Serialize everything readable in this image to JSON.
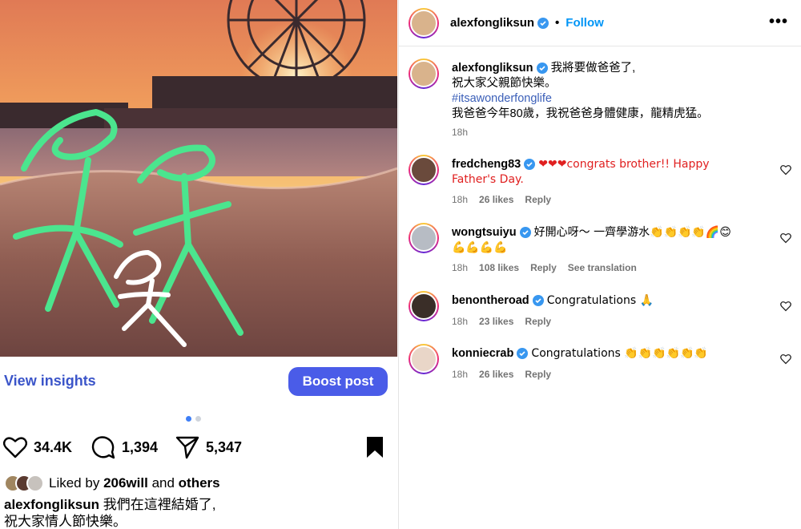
{
  "left_panel": {
    "view_insights_label": "View insights",
    "boost_label": "Boost post",
    "like_count": "34.4K",
    "comment_count": "1,394",
    "share_count": "5,347",
    "liked_by_prefix": "Liked by",
    "liked_by_user": "206will",
    "liked_by_and": "and",
    "liked_by_others": "others",
    "caption_user": "alexfongliksun",
    "caption_line1": "我們在這裡結婚了,",
    "caption_line2": "祝大家情人節快樂。",
    "carousel": {
      "count": 2,
      "active_index": 0
    }
  },
  "header": {
    "username": "alexfongliksun",
    "separator": "•",
    "follow_label": "Follow",
    "more_label": "•••"
  },
  "post_caption": {
    "username": "alexfongliksun",
    "line1": "我將要做爸爸了,",
    "line2": "祝大家父親節快樂。",
    "hashtag": "#itsawonderfonglife",
    "line3": "我爸爸今年80歲，我祝爸爸身體健康，龍精虎猛。",
    "time": "18h"
  },
  "comments": [
    {
      "username": "fredcheng83",
      "text": "❤❤❤congrats brother!! Happy Father's Day.",
      "time": "18h",
      "likes": "26 likes",
      "reply": "Reply",
      "translation": ""
    },
    {
      "username": "wongtsuiyu",
      "text": "好開心呀～ 一齊學游水👏👏👏👏🌈😊💪💪💪💪",
      "time": "18h",
      "likes": "108 likes",
      "reply": "Reply",
      "translation": "See translation"
    },
    {
      "username": "benontheroad",
      "text": "Congratulations 🙏",
      "time": "18h",
      "likes": "23 likes",
      "reply": "Reply",
      "translation": ""
    },
    {
      "username": "konniecrab",
      "text": "Congratulations 👏👏👏👏👏👏",
      "time": "18h",
      "likes": "26 likes",
      "reply": "Reply",
      "translation": ""
    }
  ],
  "colors": {
    "accent_blue": "#0095f6",
    "boost_button": "#4a5ce8",
    "insights_text": "#3b55c9",
    "doodle_green": "#4be58e",
    "verified_blue": "#3897f0"
  },
  "icons": {
    "like": "heart-icon",
    "comment": "comment-bubble-icon",
    "share": "send-icon",
    "save": "bookmark-icon",
    "verified": "verified-badge-icon",
    "more": "more-options-icon"
  }
}
